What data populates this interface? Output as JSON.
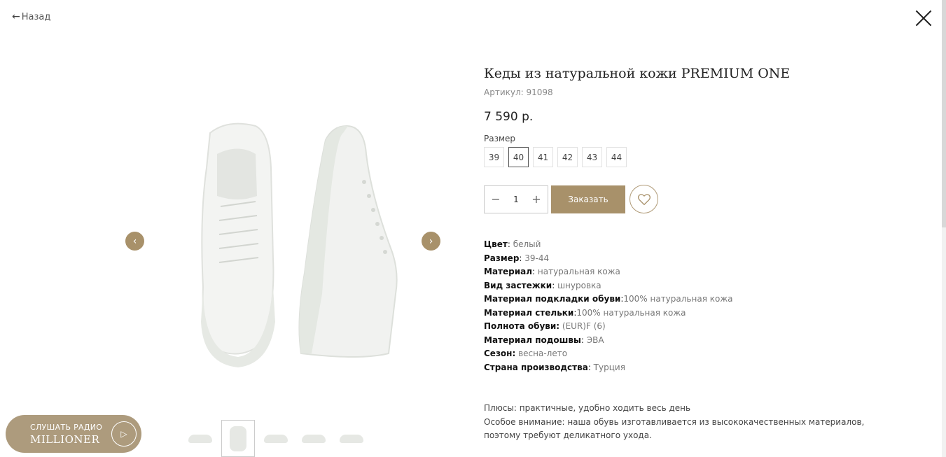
{
  "nav": {
    "back_label": "Назад",
    "back_arrow": "←"
  },
  "product": {
    "title": "Кеды из натуральной кожи PREMIUM ONE",
    "sku": "Артикул: 91098",
    "price": "7 590 р.",
    "size_label": "Размер",
    "sizes": [
      "39",
      "40",
      "41",
      "42",
      "43",
      "44"
    ],
    "selected_size": "40",
    "quantity": "1",
    "order_label": "Заказать"
  },
  "specs": [
    {
      "key": "Цвет",
      "sep": ": ",
      "value": "белый"
    },
    {
      "key": "Размер",
      "sep": ": ",
      "value": "39-44"
    },
    {
      "key": "Материал",
      "sep": ": ",
      "value": "натуральная кожа"
    },
    {
      "key": "Вид застежки",
      "sep": ": ",
      "value": "шнуровка"
    },
    {
      "key": "Материал подкладки обуви",
      "sep": ":",
      "value": "100% натуральная кожа"
    },
    {
      "key": "Материал стельки",
      "sep": ":",
      "value": "100% натуральная кожа"
    },
    {
      "key": "Полнота обуви:",
      "sep": " ",
      "value": "(EUR)F (6)"
    },
    {
      "key": "Материал подошвы",
      "sep": ": ",
      "value": "ЭВА"
    },
    {
      "key": "Сезон:",
      "sep": " ",
      "value": "весна-лето"
    },
    {
      "key": "Страна производства",
      "sep": ": ",
      "value": "Турция"
    }
  ],
  "description": {
    "line1": "Плюсы: практичные, удобно ходить весь день",
    "line2": "Особое внимание: наша обувь изготавливается из высококачественных материалов,",
    "line3": "поэтому требуют деликатного ухода."
  },
  "radio": {
    "line1": "Слушать радио",
    "line2": "MILLIONER"
  },
  "colors": {
    "accent": "#a8916a",
    "radio_bg": "#ad9b7d"
  }
}
